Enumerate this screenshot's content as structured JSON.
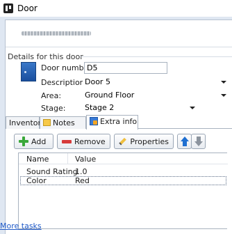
{
  "window": {
    "title": "Door"
  },
  "details": {
    "group_label": "Details for this door",
    "door_number_label": "Door number:",
    "door_number_value": "D5",
    "description_label": "Description:",
    "description_value": "Door 5",
    "area_label": "Area:",
    "area_value": "Ground Floor",
    "stage_label": "Stage:",
    "stage_value": "Stage 2"
  },
  "tabs": [
    {
      "label": "Inventory"
    },
    {
      "label": "Notes"
    },
    {
      "label": "Extra info"
    }
  ],
  "toolbar": {
    "add_label": "Add",
    "remove_label": "Remove",
    "properties_label": "Properties"
  },
  "list": {
    "columns": [
      "Name",
      "Value"
    ],
    "rows": [
      {
        "name": "Sound Rating",
        "value": "1.0"
      },
      {
        "name": "Color",
        "value": "Red"
      }
    ]
  },
  "footer": {
    "more_tasks": "More tasks"
  },
  "colors": {
    "link": "#1f5ac8",
    "frame": "#dfe7f2",
    "add_icon": "#3aa83a",
    "remove_icon": "#d63a3a",
    "move_up_icon": "#1f6fd1"
  }
}
